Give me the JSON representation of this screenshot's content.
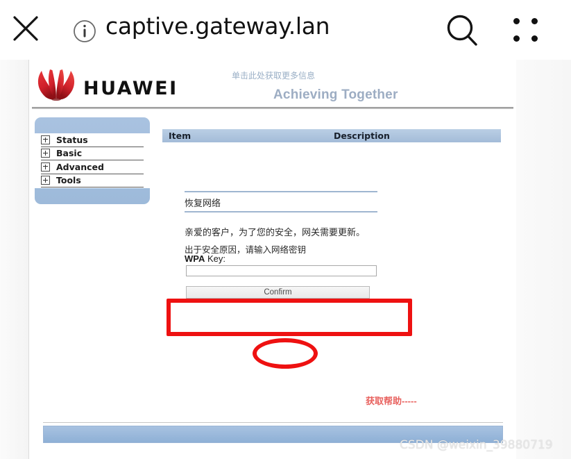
{
  "browser": {
    "close_icon": "close-x-icon",
    "info_icon": "info-circle-icon",
    "url": "captive.gateway.lan",
    "search_icon": "search-magnifier-icon",
    "menu_icon": "four-dot-menu-icon"
  },
  "brand": {
    "wordmark": "HUAWEI",
    "logo_icon": "huawei-flower-logo",
    "more_info_link": "单击此处获取更多信息",
    "tagline": "Achieving Together"
  },
  "sidebar": {
    "items": [
      {
        "label": "Status",
        "icon": "expand-plus-icon"
      },
      {
        "label": "Basic",
        "icon": "expand-plus-icon"
      },
      {
        "label": "Advanced",
        "icon": "expand-plus-icon"
      },
      {
        "label": "Tools",
        "icon": "expand-plus-icon"
      }
    ]
  },
  "table": {
    "columns": [
      "Item",
      "Description"
    ]
  },
  "main": {
    "section_title": "恢复网络",
    "notice": "亲爱的客户，为了您的安全，网关需要更新。",
    "security_prompt": "出于安全原因，请输入网络密钥",
    "wpa_label_bold": "WPA",
    "wpa_label_rest": " Key:",
    "wpa_value": "",
    "wpa_placeholder": "",
    "confirm_label": "Confirm",
    "help_text": "获取帮助-----"
  },
  "annotations": {
    "rect_color": "#ee1111",
    "ellipse_color": "#ee1111"
  },
  "watermark": "CSDN @weixin_39880719"
}
